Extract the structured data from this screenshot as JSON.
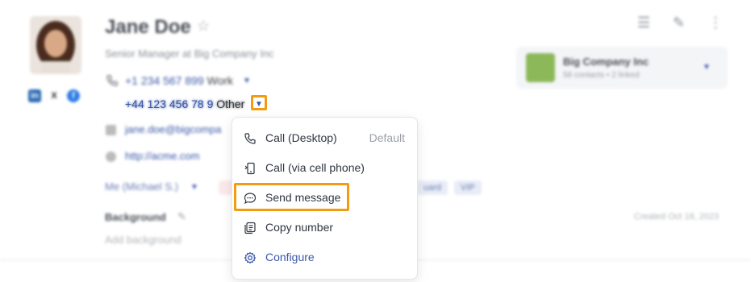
{
  "contact": {
    "name": "Jane Doe",
    "subtitle": "Senior Manager at Big Company Inc",
    "phones": [
      {
        "number": "+1 234 567 899",
        "type": "Work"
      },
      {
        "number": "+44 123 456 78 9",
        "type": "Other"
      }
    ],
    "email": "jane.doe@bigcompa",
    "website": "http://acme.com",
    "owner": "Me (Michael S.)",
    "tags": [
      "uard",
      "VIP"
    ],
    "background_label": "Background",
    "background_placeholder": "Add background",
    "created": "Created Oct 18, 2023",
    "social": [
      "linkedin",
      "x",
      "facebook"
    ]
  },
  "company": {
    "name": "Big Company Inc",
    "meta": "58 contacts • 2 linked"
  },
  "menu": {
    "items": [
      {
        "label": "Call (Desktop)",
        "extra": "Default",
        "icon": "phone-icon"
      },
      {
        "label": "Call (via cell phone)",
        "extra": "",
        "icon": "mobile-phone-icon"
      },
      {
        "label": "Send message",
        "extra": "",
        "icon": "message-bubble-icon"
      },
      {
        "label": "Copy number",
        "extra": "",
        "icon": "copy-icon"
      },
      {
        "label": "Configure",
        "extra": "",
        "icon": "gear-icon"
      }
    ]
  },
  "colors": {
    "accent": "#3a58a8",
    "highlight": "#f39c12"
  }
}
